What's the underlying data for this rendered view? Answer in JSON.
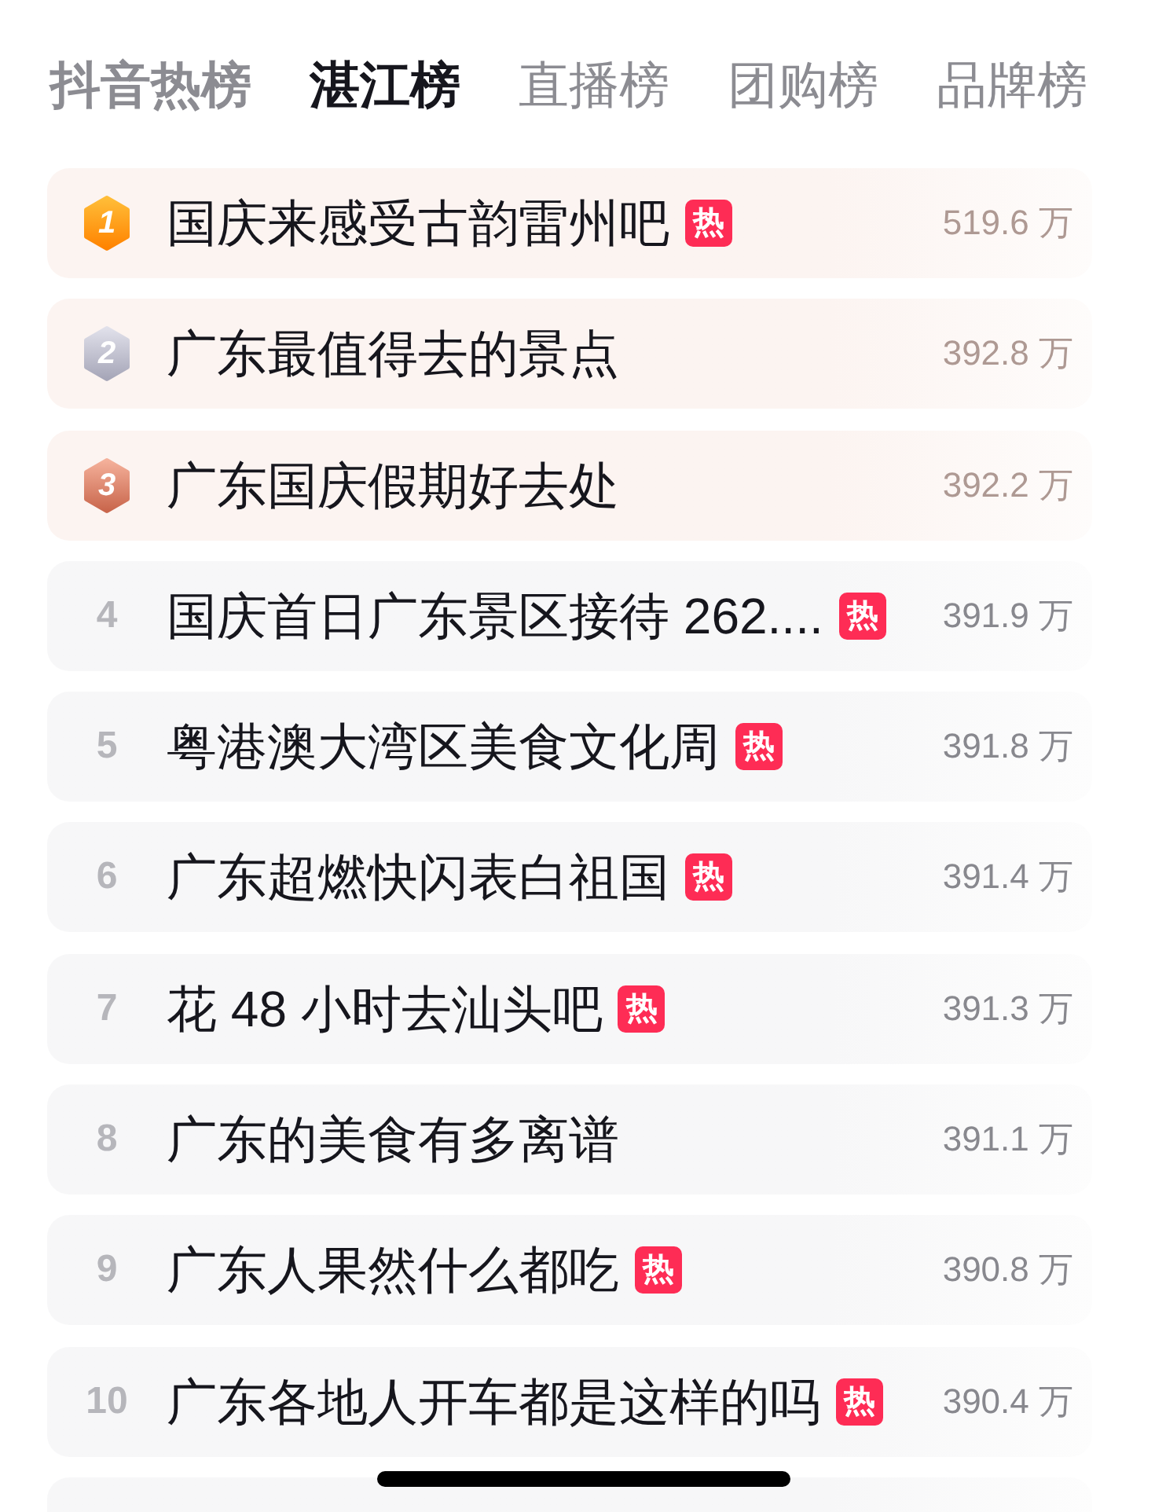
{
  "tabs": [
    {
      "label": "抖音热榜",
      "emphasis": true,
      "selected": false
    },
    {
      "label": "湛江榜",
      "emphasis": true,
      "selected": true
    },
    {
      "label": "直播榜",
      "emphasis": false,
      "selected": false
    },
    {
      "label": "团购榜",
      "emphasis": false,
      "selected": false
    },
    {
      "label": "品牌榜",
      "emphasis": false,
      "selected": false
    }
  ],
  "rows": [
    {
      "rank": "1",
      "kind": "gold",
      "title": "国庆来感受古韵雷州吧",
      "tag": "热",
      "count": "519.6 万"
    },
    {
      "rank": "2",
      "kind": "silver",
      "title": "广东最值得去的景点",
      "count": "392.8 万"
    },
    {
      "rank": "3",
      "kind": "bronze",
      "title": "广东国庆假期好去处",
      "count": "392.2 万"
    },
    {
      "rank": "4",
      "kind": "plain",
      "title": "国庆首日广东景区接待 262....",
      "tag": "热",
      "count": "391.9 万"
    },
    {
      "rank": "5",
      "kind": "plain",
      "title": "粤港澳大湾区美食文化周",
      "tag": "热",
      "count": "391.8 万"
    },
    {
      "rank": "6",
      "kind": "plain",
      "title": "广东超燃快闪表白祖国",
      "tag": "热",
      "count": "391.4 万"
    },
    {
      "rank": "7",
      "kind": "plain",
      "title": "花 48 小时去汕头吧",
      "tag": "热",
      "count": "391.3 万"
    },
    {
      "rank": "8",
      "kind": "plain",
      "title": "广东的美食有多离谱",
      "count": "391.1 万"
    },
    {
      "rank": "9",
      "kind": "plain",
      "title": "广东人果然什么都吃",
      "tag": "热",
      "count": "390.8 万"
    },
    {
      "rank": "10",
      "kind": "plain",
      "title": "广东各地人开车都是这样的吗",
      "tag": "热",
      "count": "390.4 万"
    }
  ]
}
